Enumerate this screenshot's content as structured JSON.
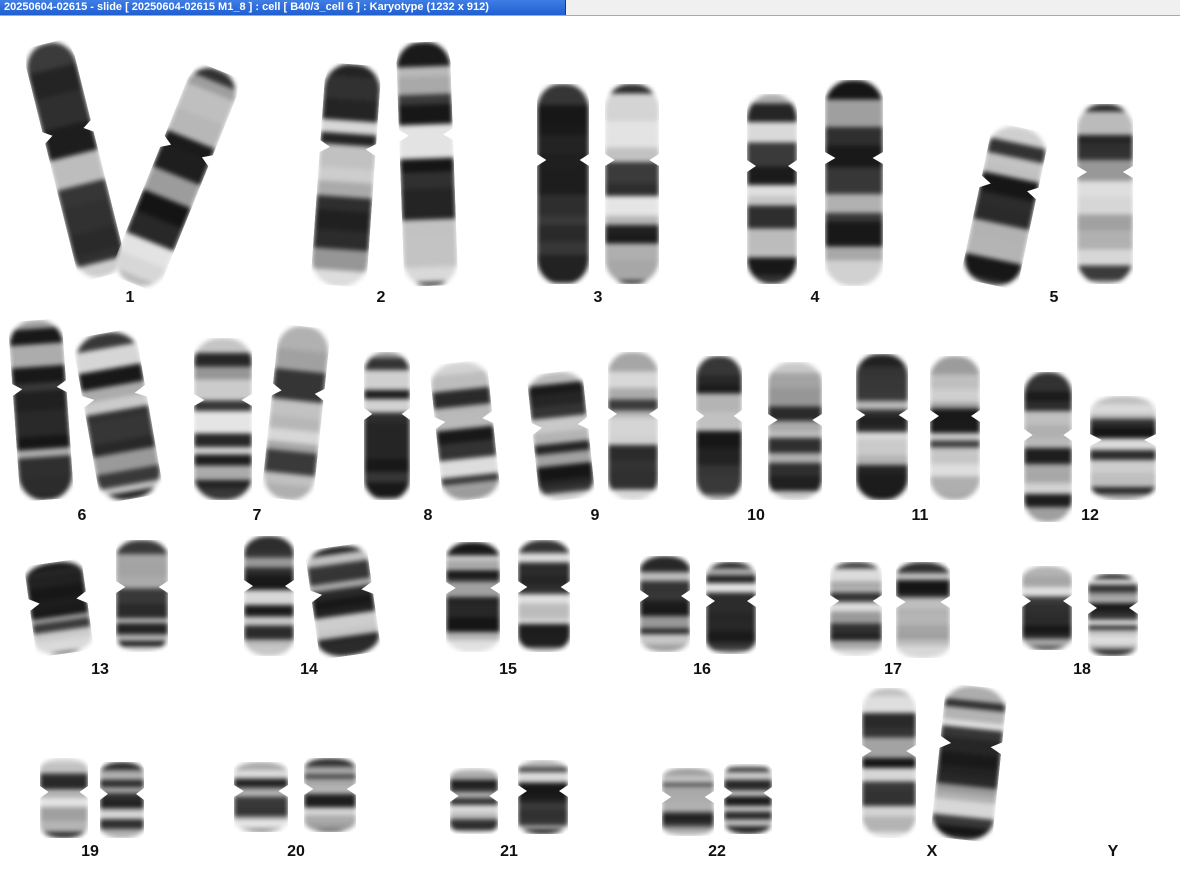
{
  "window": {
    "title": "20250604-02615 - slide [ 20250604-02615 M1_8 ] : cell [ B40/3_cell 6 ] : Karyotype  (1232 x 912)"
  },
  "colors": {
    "title_bar": "#1f5fd0",
    "title_text": "#ffffff",
    "background": "#ffffff",
    "chromosome_dark": "#1a1a1a",
    "chromosome_light": "#c8c8c8"
  },
  "karyotype": {
    "labels": [
      "1",
      "2",
      "3",
      "4",
      "5",
      "6",
      "7",
      "8",
      "9",
      "10",
      "11",
      "12",
      "13",
      "14",
      "15",
      "16",
      "17",
      "18",
      "19",
      "20",
      "21",
      "22",
      "X",
      "Y"
    ]
  }
}
